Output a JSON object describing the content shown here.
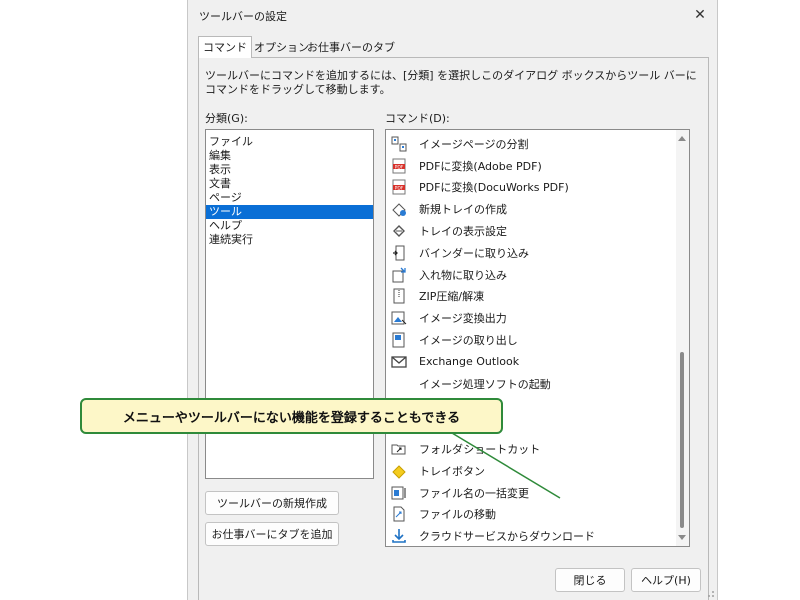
{
  "dialog": {
    "title": "ツールバーの設定",
    "close_glyph": "✕",
    "tabs": [
      "コマンド",
      "オプション",
      "お仕事バーのタブ"
    ],
    "description": "ツールバーにコマンドを追加するには、[分類] を選択しこのダイアログ ボックスからツール バーにコマンドをドラッグして移動します。",
    "category_label": "分類(G):",
    "command_label": "コマンド(D):",
    "categories": [
      "ファイル",
      "編集",
      "表示",
      "文書",
      "ページ",
      "ツール",
      "ヘルプ",
      "連続実行"
    ],
    "selected_category": "ツール",
    "commands": [
      {
        "label": "イメージページの分割",
        "icon": "split-page-icon"
      },
      {
        "label": "PDFに変換(Adobe PDF)",
        "icon": "pdf-icon"
      },
      {
        "label": "PDFに変換(DocuWorks PDF)",
        "icon": "pdf-icon"
      },
      {
        "label": "新規トレイの作成",
        "icon": "new-tray-icon"
      },
      {
        "label": "トレイの表示設定",
        "icon": "tray-settings-icon"
      },
      {
        "label": "バインダーに取り込み",
        "icon": "binder-icon"
      },
      {
        "label": "入れ物に取り込み",
        "icon": "container-icon"
      },
      {
        "label": "ZIP圧縮/解凍",
        "icon": "zip-icon"
      },
      {
        "label": "イメージ変換出力",
        "icon": "image-export-icon"
      },
      {
        "label": "イメージの取り出し",
        "icon": "image-extract-icon"
      },
      {
        "label": "Exchange Outlook",
        "icon": "mail-icon"
      },
      {
        "label": "イメージ処理ソフトの起動",
        "icon": ""
      },
      {
        "label": "",
        "icon": ""
      },
      {
        "label": "",
        "icon": ""
      },
      {
        "label": "フォルダショートカット",
        "icon": "folder-shortcut-icon"
      },
      {
        "label": "トレイボタン",
        "icon": "tray-button-icon"
      },
      {
        "label": "ファイル名の一括変更",
        "icon": "rename-icon"
      },
      {
        "label": "ファイルの移動",
        "icon": "file-move-icon"
      },
      {
        "label": "クラウドサービスからダウンロード",
        "icon": "download-icon"
      }
    ],
    "buttons": {
      "new_toolbar": "ツールバーの新規作成",
      "add_tab": "お仕事バーにタブを追加",
      "close": "閉じる",
      "help": "ヘルプ(H)"
    }
  },
  "callout": {
    "text": "メニューやツールバーにない機能を登録することもできる",
    "border_color": "#2f8a3a",
    "background_color": "#fdf7c8"
  },
  "colors": {
    "selection": "#0a6fd6",
    "dialog_bg": "#f0f0f0"
  }
}
